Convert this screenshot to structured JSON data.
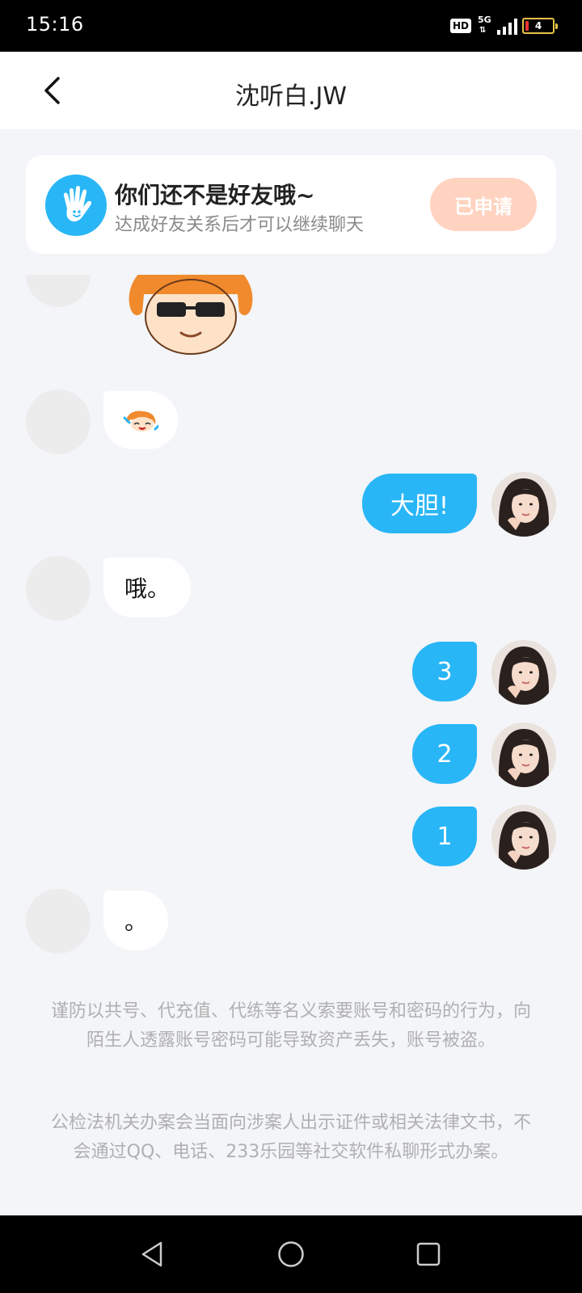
{
  "status_bar": {
    "time": "15:16",
    "hd": "HD",
    "network_type": "5G",
    "battery_level": "4"
  },
  "header": {
    "title": "沈听白.JW"
  },
  "friend_banner": {
    "title": "你们还不是好友哦~",
    "subtitle": "达成好友关系后才可以继续聊天",
    "button_label": "已申请",
    "button_color": "#ffd3c0"
  },
  "messages": [
    {
      "side": "in",
      "type": "sticker",
      "sticker": "orange-hair-sunglasses-sticker"
    },
    {
      "side": "in",
      "type": "sticker",
      "sticker": "small-crying-emoji-sticker"
    },
    {
      "side": "out",
      "type": "text",
      "text": "大胆!"
    },
    {
      "side": "in",
      "type": "text",
      "text": "哦。"
    },
    {
      "side": "out",
      "type": "text",
      "text": "3"
    },
    {
      "side": "out",
      "type": "text",
      "text": "2"
    },
    {
      "side": "out",
      "type": "text",
      "text": "1"
    },
    {
      "side": "in",
      "type": "text",
      "text": "。"
    }
  ],
  "notices": [
    "谨防以共号、代充值、代练等名义索要账号和密码的行为，向陌生人透露账号密码可能导致资产丢失，账号被盗。",
    "公检法机关办案会当面向涉案人出示证件或相关法律文书，不会通过QQ、电话、233乐园等社交软件私聊形式办案。"
  ],
  "colors": {
    "accent": "#29b6f6",
    "background": "#f3f5f8",
    "notice_text": "#b0b0b0"
  }
}
